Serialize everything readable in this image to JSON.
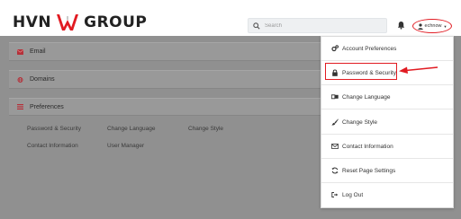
{
  "header": {
    "logo_left": "HVN",
    "logo_right": "GROUP",
    "search_placeholder": "Search",
    "user_name": "echnow"
  },
  "panels": [
    {
      "label": "Email"
    },
    {
      "label": "Domains"
    },
    {
      "label": "Preferences"
    }
  ],
  "preferences": {
    "links": [
      "Password & Security",
      "Change Language",
      "Change Style",
      "Contact Information",
      "User Manager"
    ]
  },
  "dropdown": {
    "items": [
      {
        "label": "Account Preferences",
        "icon": "gears-icon"
      },
      {
        "label": "Password & Security",
        "icon": "lock-icon"
      },
      {
        "label": "Change Language",
        "icon": "language-icon"
      },
      {
        "label": "Change Style",
        "icon": "brush-icon"
      },
      {
        "label": "Contact Information",
        "icon": "envelope-icon"
      },
      {
        "label": "Reset Page Settings",
        "icon": "refresh-icon"
      },
      {
        "label": "Log Out",
        "icon": "sign-out-icon"
      }
    ]
  },
  "colors": {
    "accent_red": "#e11b22",
    "overlay": "#909090"
  }
}
